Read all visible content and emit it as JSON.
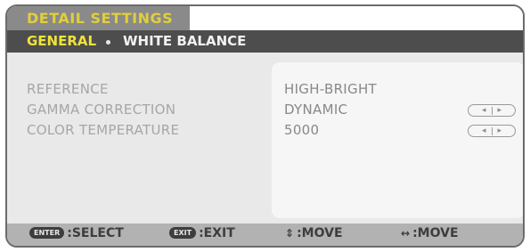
{
  "title": "DETAIL SETTINGS",
  "tabs": [
    {
      "label": "GENERAL",
      "active": true
    },
    {
      "label": "WHITE BALANCE",
      "active": false
    }
  ],
  "settings": [
    {
      "label": "REFERENCE",
      "value": "HIGH-BRIGHT",
      "has_arrows": false
    },
    {
      "label": "GAMMA CORRECTION",
      "value": "DYNAMIC",
      "has_arrows": true
    },
    {
      "label": "COLOR TEMPERATURE",
      "value": "5000",
      "has_arrows": true
    }
  ],
  "arrows": {
    "left": "◂",
    "right": "▸"
  },
  "footer": {
    "select": {
      "key": "ENTER",
      "label": ":SELECT"
    },
    "exit": {
      "key": "EXIT",
      "label": ":EXIT"
    },
    "move_vertical": {
      "icon": "⇕",
      "label": ":MOVE"
    },
    "move_horizontal": {
      "icon": "↔",
      "label": ":MOVE"
    }
  },
  "colors": {
    "title_text": "#e0cf3c",
    "active_tab": "#f0e23a",
    "tab_bar": "#4d4d4d",
    "footer_bg": "#b2b2b2"
  }
}
